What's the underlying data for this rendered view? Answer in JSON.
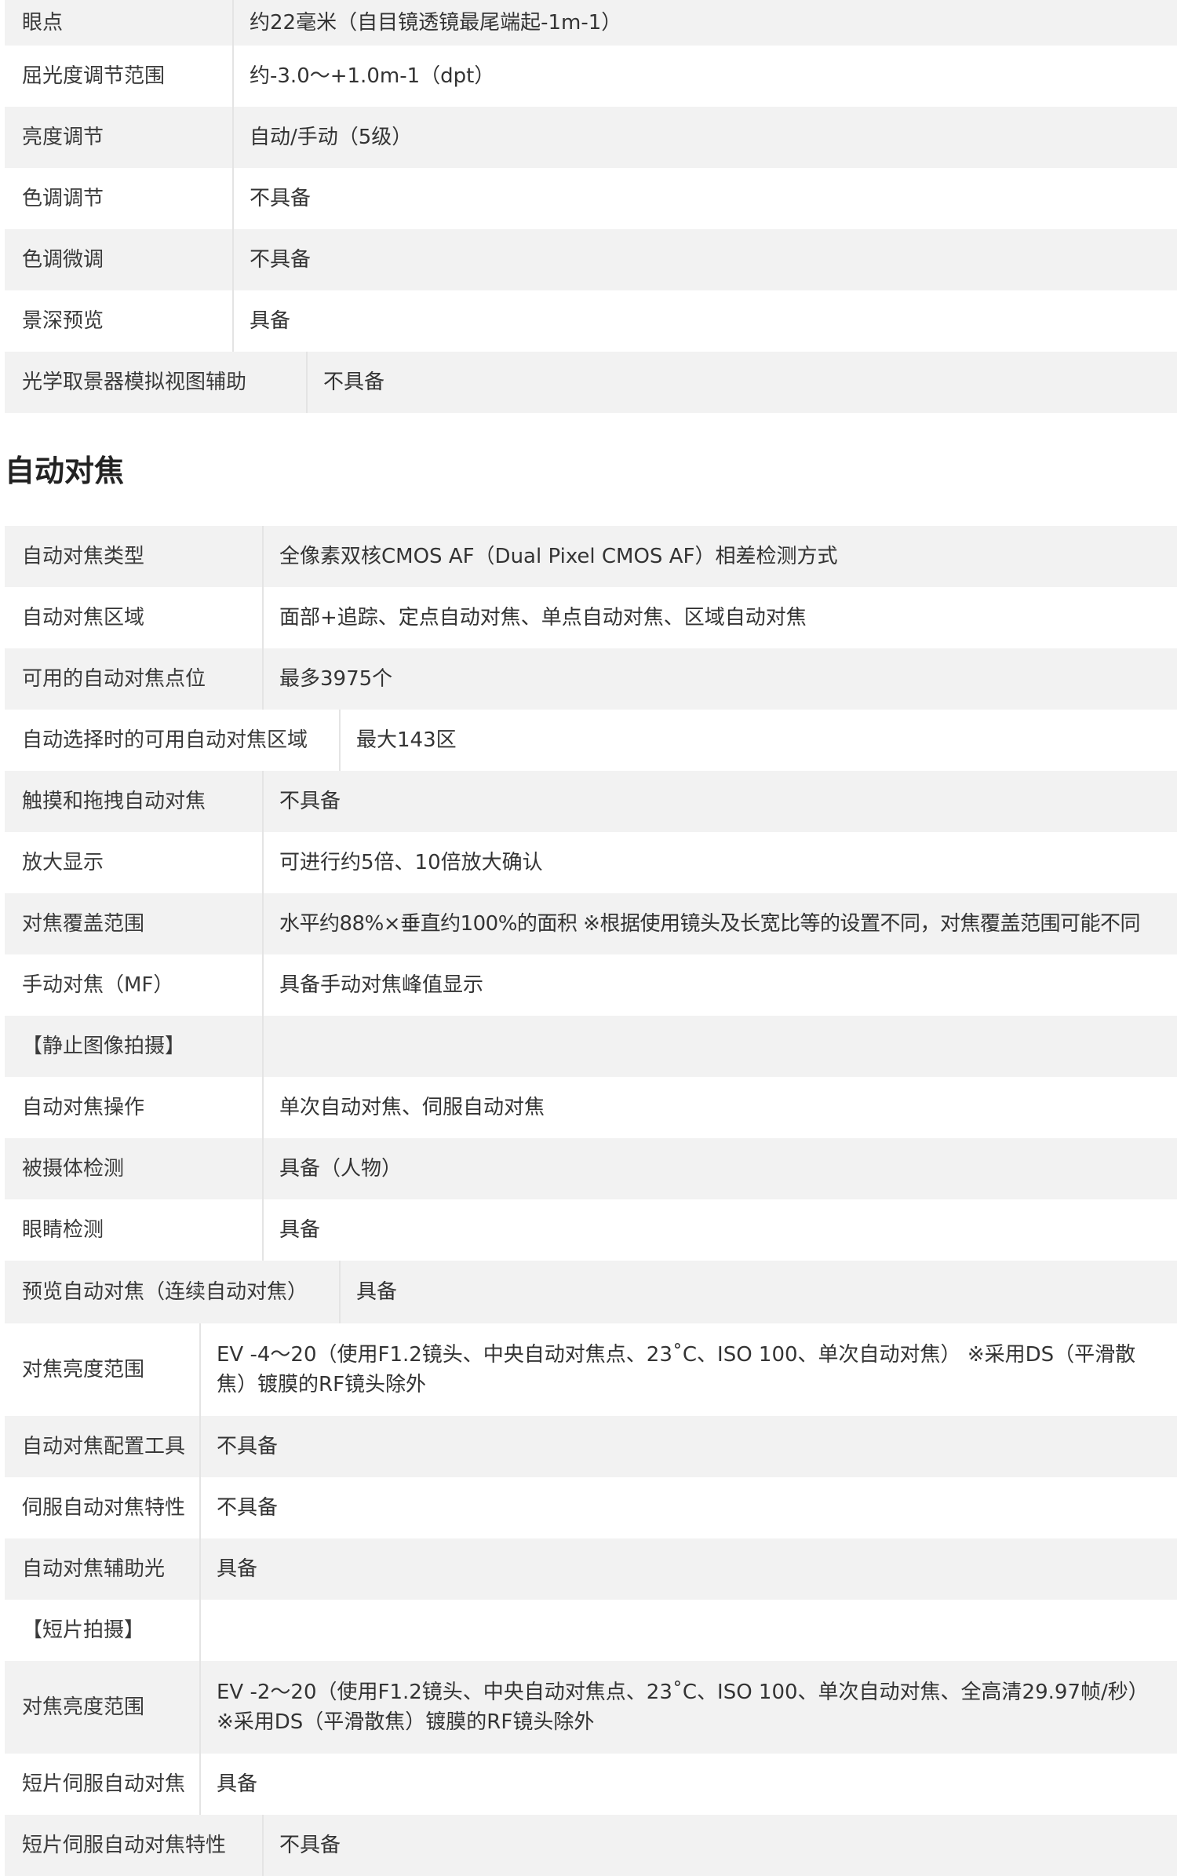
{
  "viewfinder_table": {
    "rows": [
      {
        "label": "眼点",
        "value": "约22毫米（自目镜透镜最尾端起-1m-1）"
      },
      {
        "label": "屈光度调节范围",
        "value": "约-3.0～+1.0m-1（dpt）"
      },
      {
        "label": "亮度调节",
        "value": "自动/手动（5级）"
      },
      {
        "label": "色调调节",
        "value": "不具备"
      },
      {
        "label": "色调微调",
        "value": "不具备"
      },
      {
        "label": "景深预览",
        "value": "具备"
      },
      {
        "label": "光学取景器模拟视图辅助",
        "value": "不具备"
      }
    ]
  },
  "af_section": {
    "title": "自动对焦",
    "rows": [
      {
        "label": "自动对焦类型",
        "value": "全像素双核CMOS AF（Dual Pixel CMOS AF）相差检测方式"
      },
      {
        "label": "自动对焦区域",
        "value": "面部+追踪、定点自动对焦、单点自动对焦、区域自动对焦"
      },
      {
        "label": "可用的自动对焦点位",
        "value": "最多3975个"
      },
      {
        "label": "自动选择时的可用自动对焦区域",
        "value": "最大143区"
      },
      {
        "label": "触摸和拖拽自动对焦",
        "value": "不具备"
      },
      {
        "label": "放大显示",
        "value": "可进行约5倍、10倍放大确认"
      },
      {
        "label": "对焦覆盖范围",
        "value": "水平约88%×垂直约100%的面积 ※根据使用镜头及长宽比等的设置不同，对焦覆盖范围可能不同"
      },
      {
        "label": "手动对焦（MF）",
        "value": "具备手动对焦峰值显示"
      },
      {
        "label": "【静止图像拍摄】",
        "value": ""
      },
      {
        "label": "自动对焦操作",
        "value": "单次自动对焦、伺服自动对焦"
      },
      {
        "label": "被摄体检测",
        "value": "具备（人物）"
      },
      {
        "label": "眼睛检测",
        "value": "具备"
      },
      {
        "label": "预览自动对焦（连续自动对焦）",
        "value": "具备"
      },
      {
        "label": "对焦亮度范围",
        "value": "EV -4～20（使用F1.2镜头、中央自动对焦点、23˚C、ISO 100、单次自动对焦） ※采用DS（平滑散焦）镀膜的RF镜头除外"
      },
      {
        "label": "自动对焦配置工具",
        "value": "不具备"
      },
      {
        "label": "伺服自动对焦特性",
        "value": "不具备"
      },
      {
        "label": "自动对焦辅助光",
        "value": "具备"
      },
      {
        "label": "【短片拍摄】",
        "value": ""
      },
      {
        "label": "对焦亮度范围",
        "value": "EV -2～20（使用F1.2镜头、中央自动对焦点、23˚C、ISO 100、单次自动对焦、全高清29.97帧/秒） ※采用DS（平滑散焦）镀膜的RF镜头除外"
      },
      {
        "label": "短片伺服自动对焦",
        "value": "具备"
      },
      {
        "label": "短片伺服自动对焦特性",
        "value": "不具备"
      }
    ]
  }
}
